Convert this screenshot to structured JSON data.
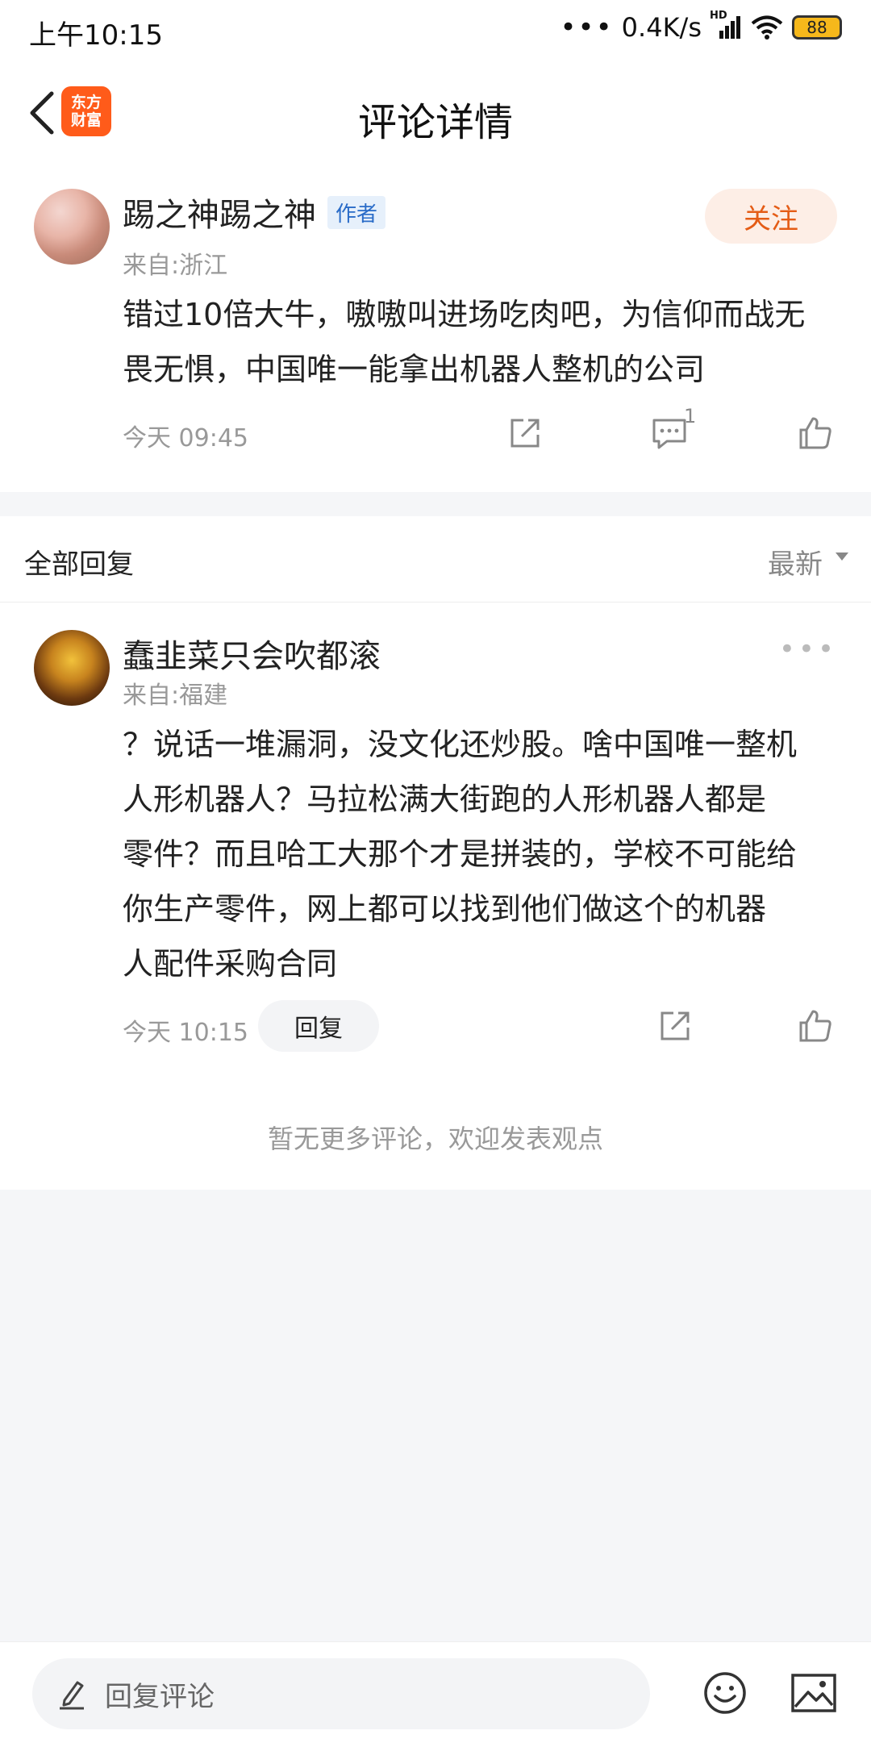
{
  "status_bar": {
    "time": "上午10:15",
    "dots": "•••",
    "speed": "0.4K/s",
    "hd_label": "HD",
    "battery": "88"
  },
  "header": {
    "title": "评论详情",
    "logo_line1": "东方",
    "logo_line2": "财富"
  },
  "main_comment": {
    "username": "踢之神踢之神",
    "badge": "作者",
    "follow_label": "关注",
    "location": "来自:浙江",
    "content_line1": "错过10倍大牛，嗷嗷叫进场吃肉吧，为信仰而战无",
    "content_line2": "畏无惧，中国唯一能拿出机器人整机的公司",
    "time": "今天 09:45",
    "comment_count": "1"
  },
  "replies": {
    "title": "全部回复",
    "sort_label": "最新",
    "items": [
      {
        "username": "蠢韭菜只会吹都滚",
        "location": "来自:福建",
        "content_lines": [
          "？说话一堆漏洞，没文化还炒股。啥中国唯一整机",
          "人形机器人？马拉松满大街跑的人形机器人都是",
          "零件？而且哈工大那个才是拼装的，学校不可能给",
          "你生产零件，网上都可以找到他们做这个的机器",
          "人配件采购合同"
        ],
        "time": "今天 10:15",
        "reply_label": "回复"
      }
    ],
    "end_note": "暂无更多评论，欢迎发表观点"
  },
  "bottom_bar": {
    "placeholder": "回复评论"
  },
  "colors": {
    "accent": "#e45c16",
    "logo": "#ff5b1a",
    "badge_bg": "#e6f0fb",
    "badge_text": "#2a6cc8"
  }
}
